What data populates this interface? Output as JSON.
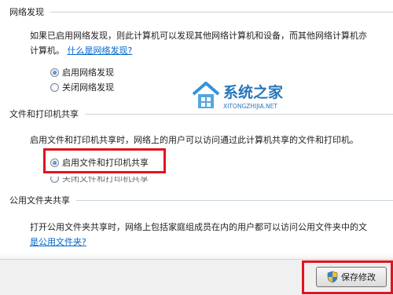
{
  "network_discovery": {
    "title": "网络发现",
    "desc_line1": "如果已启用网络发现，则此计算机可以发现其他网络计算机和设备，而其他网络计算机亦",
    "desc_line2": "计算机。",
    "link": "什么是网络发现?",
    "options": [
      "启用网络发现",
      "关闭网络发现"
    ],
    "selected": 0
  },
  "file_printer_sharing": {
    "title": "文件和打印机共享",
    "desc": "启用文件和打印机共享时，网络上的用户可以访问通过此计算机共享的文件和打印机。",
    "options": [
      "启用文件和打印机共享",
      "关闭文件和打印机共享"
    ],
    "selected": 0
  },
  "public_folder_sharing": {
    "title": "公用文件夹共享",
    "desc": "打开公用文件夹共享时，网络上包括家庭组成员在内的用户都可以访问公用文件夹中的文",
    "link": "是公用文件夹?"
  },
  "footer": {
    "save_label": "保存修改"
  },
  "watermark": {
    "text_cn": "系统之家",
    "text_en": "XITONGZHIJIA.NET"
  },
  "colors": {
    "highlight_box": "#e0141e",
    "link": "#0066cc"
  }
}
